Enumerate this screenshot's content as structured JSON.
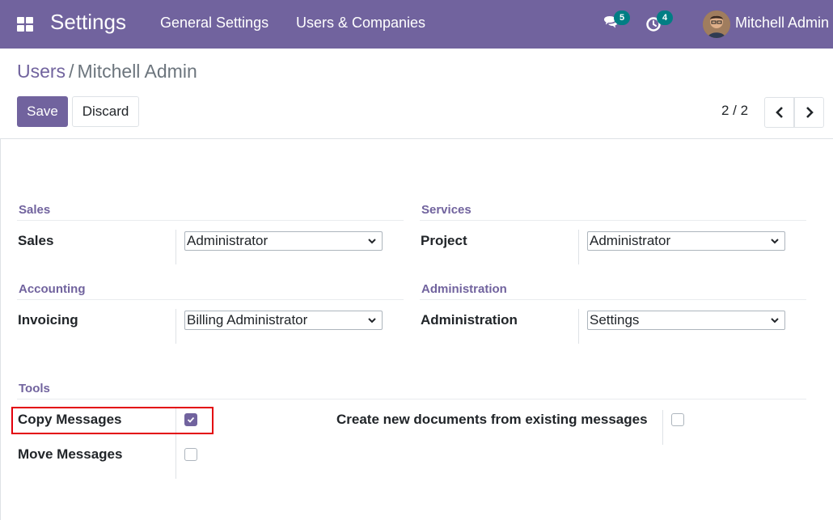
{
  "navbar": {
    "app_title": "Settings",
    "menu": [
      "General Settings",
      "Users & Companies"
    ],
    "messages_count": "5",
    "activities_count": "4",
    "user_name": "Mitchell Admin"
  },
  "breadcrumb": {
    "parent": "Users",
    "separator": "/",
    "current": "Mitchell Admin"
  },
  "buttons": {
    "save": "Save",
    "discard": "Discard"
  },
  "pager": {
    "value": "2 / 2"
  },
  "groups": {
    "sales": {
      "title": "Sales",
      "field_label": "Sales",
      "value": "Administrator"
    },
    "services": {
      "title": "Services",
      "field_label": "Project",
      "value": "Administrator"
    },
    "accounting": {
      "title": "Accounting",
      "field_label": "Invoicing",
      "value": "Billing Administrator"
    },
    "administration": {
      "title": "Administration",
      "field_label": "Administration",
      "value": "Settings"
    },
    "tools": {
      "title": "Tools",
      "copy_messages": {
        "label": "Copy Messages",
        "checked": true
      },
      "move_messages": {
        "label": "Move Messages",
        "checked": false
      },
      "create_documents": {
        "label": "Create new documents from existing messages",
        "checked": false
      }
    }
  },
  "colors": {
    "brand": "#71639e",
    "badge": "#017e84",
    "highlight": "#e3000b"
  }
}
